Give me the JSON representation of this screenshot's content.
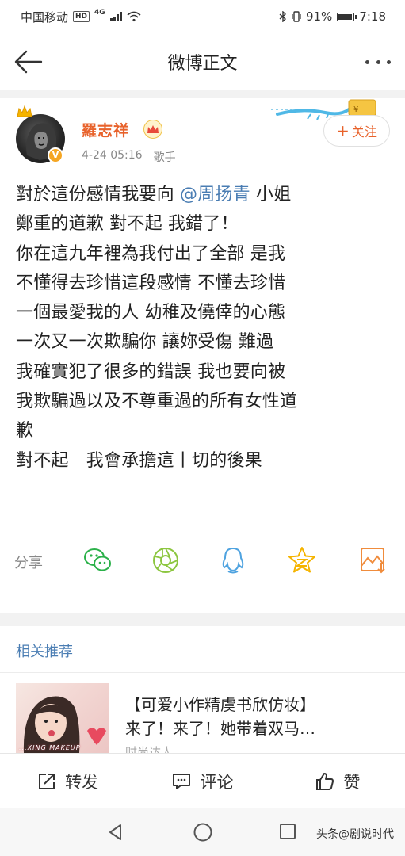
{
  "status_bar": {
    "carrier": "中国移动",
    "hd": "HD",
    "network": "4G",
    "battery": "91%",
    "time": "7:18",
    "battery_level": 0.91
  },
  "header": {
    "title": "微博正文"
  },
  "post": {
    "author": "羅志祥",
    "date": "4-24 05:16",
    "role": "歌手",
    "follow_label": "关注",
    "lines": [
      {
        "before": "對於這份感情我要向 ",
        "mention": "@周扬青",
        "after": " 小姐"
      },
      {
        "text": "鄭重的道歉 對不起 我錯了！"
      },
      {
        "text": "你在這九年裡為我付出了全部 是我"
      },
      {
        "text": "不懂得去珍惜這段感情 不懂去珍惜"
      },
      {
        "text": "一個最愛我的人 幼稚及僥倖的心態"
      },
      {
        "text": "一次又一次欺騙你 讓妳受傷 難過"
      },
      {
        "text": "我確實犯了很多的錯誤 我也要向被"
      },
      {
        "text": "我欺騙過以及不尊重過的所有女性道"
      },
      {
        "text": "歉"
      },
      {
        "text": "對不起　我會承擔這丨切的後果"
      }
    ],
    "share_label": "分享",
    "share_targets": [
      "wechat-icon",
      "moments-icon",
      "qq-icon",
      "qzone-icon",
      "save-image-icon"
    ]
  },
  "related": {
    "title": "相关推荐",
    "headline_line1": "【可爱小作精虞书欣仿妆】",
    "headline_line2": "来了！来了！她带着双马…",
    "thumb_caption": "...XING MAKEUP",
    "source": "时尚达人"
  },
  "actions": {
    "repost": "转发",
    "comment": "评论",
    "like": "赞"
  },
  "watermark": "头条@剧说时代",
  "colors": {
    "accent_orange": "#e8622b",
    "link_blue": "#4a7db3",
    "wechat_green": "#2bb14a",
    "moments_green": "#8cc63f",
    "qq_blue": "#4fa3e0",
    "qzone_yellow": "#f5b400",
    "save_orange": "#f08c3c"
  }
}
